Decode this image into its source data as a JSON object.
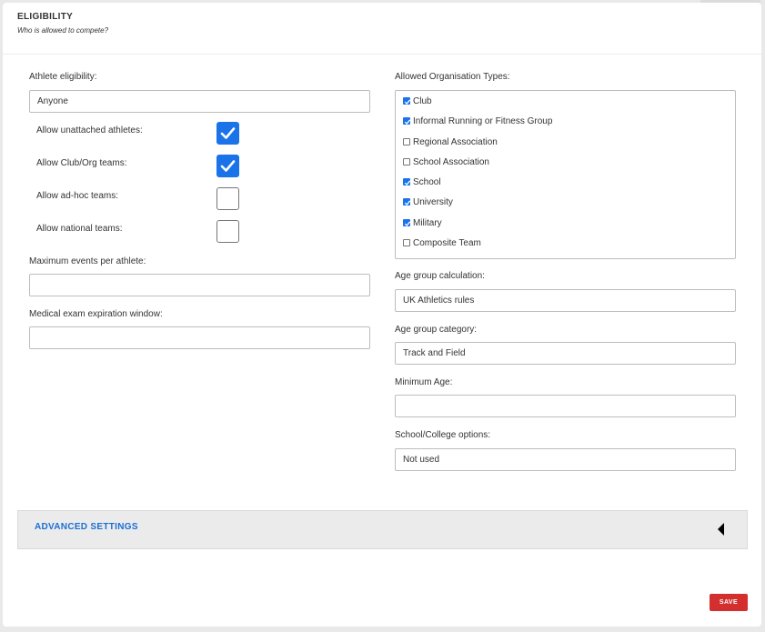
{
  "header": {
    "title": "ELIGIBILITY",
    "subtitle": "Who is allowed to compete?"
  },
  "left": {
    "athlete_eligibility_label": "Athlete eligibility:",
    "athlete_eligibility_value": "Anyone",
    "toggles": [
      {
        "label": "Allow unattached athletes:",
        "checked": true
      },
      {
        "label": "Allow Club/Org teams:",
        "checked": true
      },
      {
        "label": "Allow ad-hoc teams:",
        "checked": false
      },
      {
        "label": "Allow national teams:",
        "checked": false
      }
    ],
    "max_events_label": "Maximum events per athlete:",
    "max_events_value": "",
    "medical_label": "Medical exam expiration window:",
    "medical_value": ""
  },
  "right": {
    "org_types_label": "Allowed Organisation Types:",
    "org_types": [
      {
        "label": "Club",
        "checked": true
      },
      {
        "label": "Informal Running or Fitness Group",
        "checked": true
      },
      {
        "label": "Regional Association",
        "checked": false
      },
      {
        "label": "School Association",
        "checked": false
      },
      {
        "label": "School",
        "checked": true
      },
      {
        "label": "University",
        "checked": true
      },
      {
        "label": "Military",
        "checked": true
      },
      {
        "label": "Composite Team",
        "checked": false
      }
    ],
    "age_calc_label": "Age group calculation:",
    "age_calc_value": "UK Athletics rules",
    "age_category_label": "Age group category:",
    "age_category_value": "Track and Field",
    "min_age_label": "Minimum Age:",
    "min_age_value": "",
    "school_options_label": "School/College options:",
    "school_options_value": "Not used"
  },
  "advanced": {
    "label": "ADVANCED SETTINGS",
    "icon": "caret-left-icon"
  },
  "actions": {
    "save_label": "SAVE"
  },
  "colors": {
    "accent": "#1a73e8",
    "link": "#1a6fd6",
    "save": "#d32f2f"
  }
}
